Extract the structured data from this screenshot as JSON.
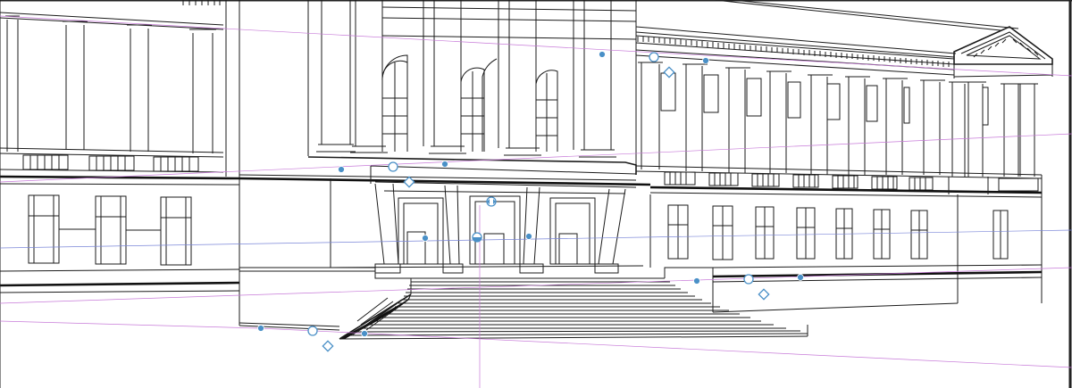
{
  "document": {
    "subject": "building-facade-line-drawing",
    "tool_state": "perspective-ruler-visible"
  },
  "colors": {
    "canvas": "#ffffff",
    "ink": "#1b1b1b",
    "guide_violet": "#c77ad8",
    "guide_blue": "#7a86d8",
    "handle": "#4a90c7"
  }
}
